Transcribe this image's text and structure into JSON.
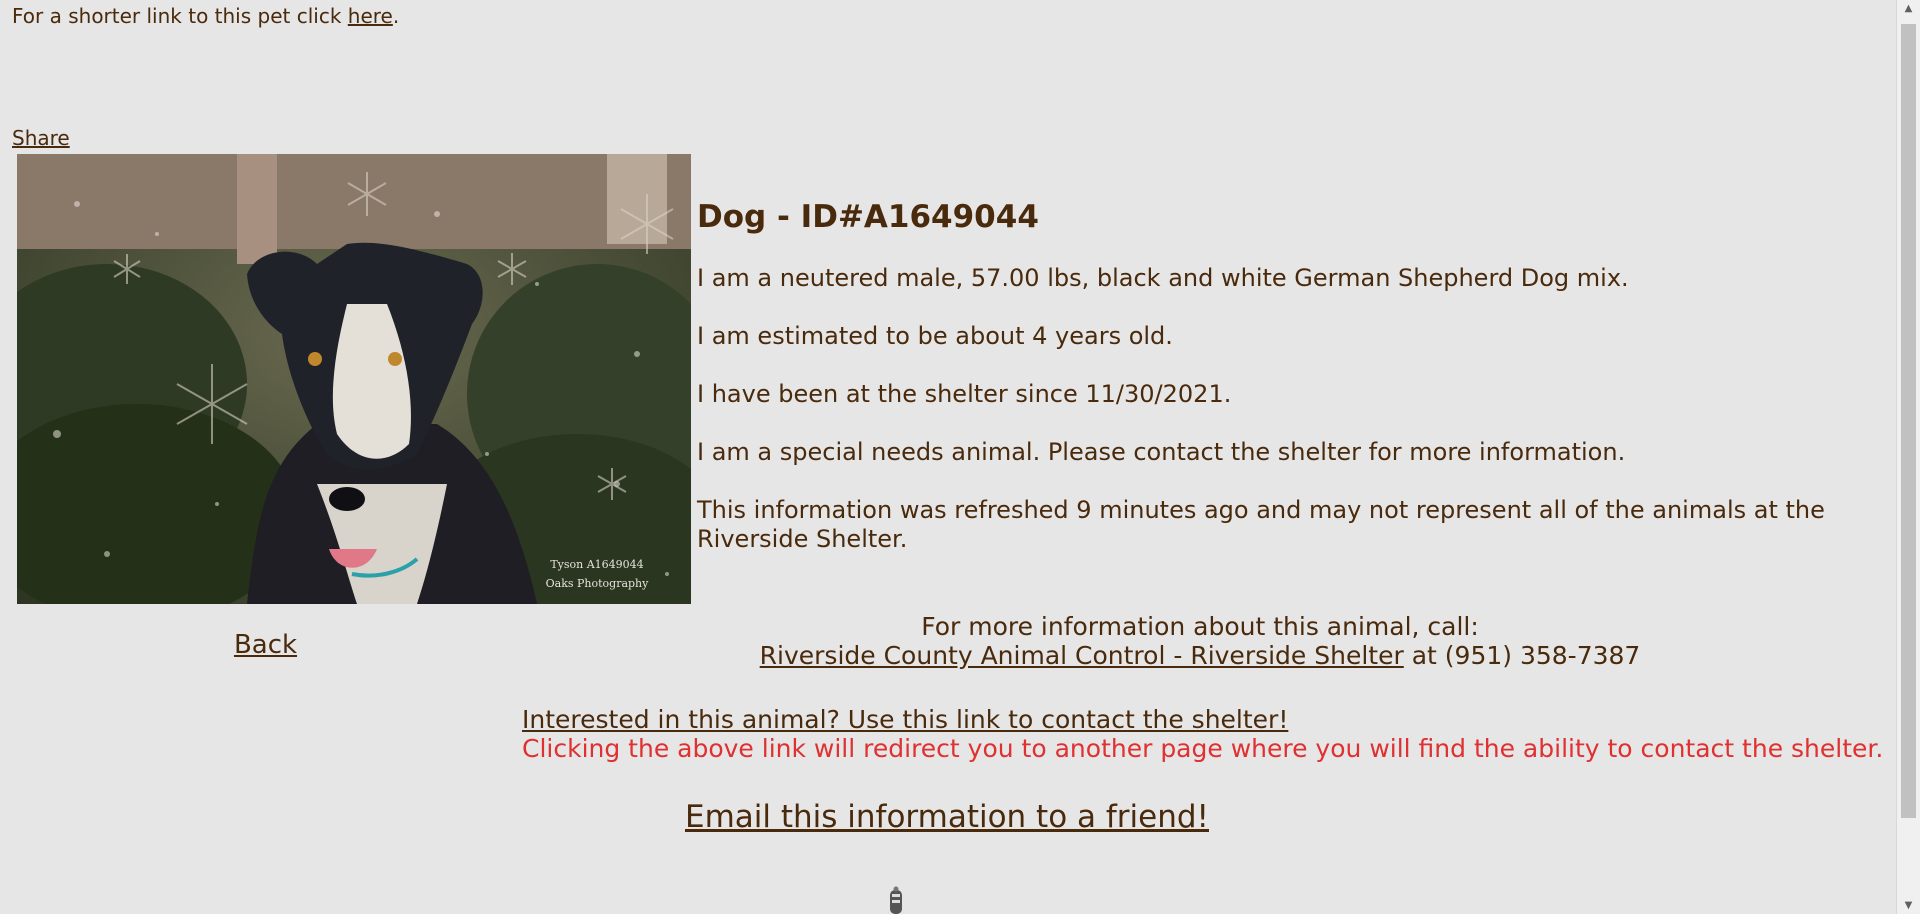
{
  "shortlink": {
    "text": "For a shorter link to this pet click ",
    "link_label": "here",
    "end": "."
  },
  "share_label": "Share",
  "photo": {
    "caption_line1": "Tyson A1649044",
    "caption_line2": "Oaks Photography"
  },
  "back_label": "Back",
  "animal": {
    "title": "Dog - ID#A1649044",
    "description": "I am a neutered male, 57.00 lbs, black and white German Shepherd Dog mix.",
    "age": "I am estimated to be about 4 years old.",
    "since": "I have been at the shelter since 11/30/2021.",
    "special_needs": "I am a special needs animal. Please contact the shelter for more information.",
    "refreshed": "This information was refreshed 9 minutes ago and may not represent all of the animals at the Riverside Shelter."
  },
  "contact": {
    "line1": "For more information about this animal, call:",
    "shelter_link": "Riverside County Animal Control - Riverside Shelter",
    "phone_text": " at (951) 358-7387"
  },
  "interested": {
    "link_label": "Interested in this animal? Use this link to contact the shelter!",
    "warning": "Clicking the above link will redirect you to another page where you will find the ability to contact the shelter."
  },
  "email_label": "Email this information to a friend!",
  "colors": {
    "background": "#e6e6e6",
    "text": "#4a2a0c",
    "warning": "#e03030"
  }
}
